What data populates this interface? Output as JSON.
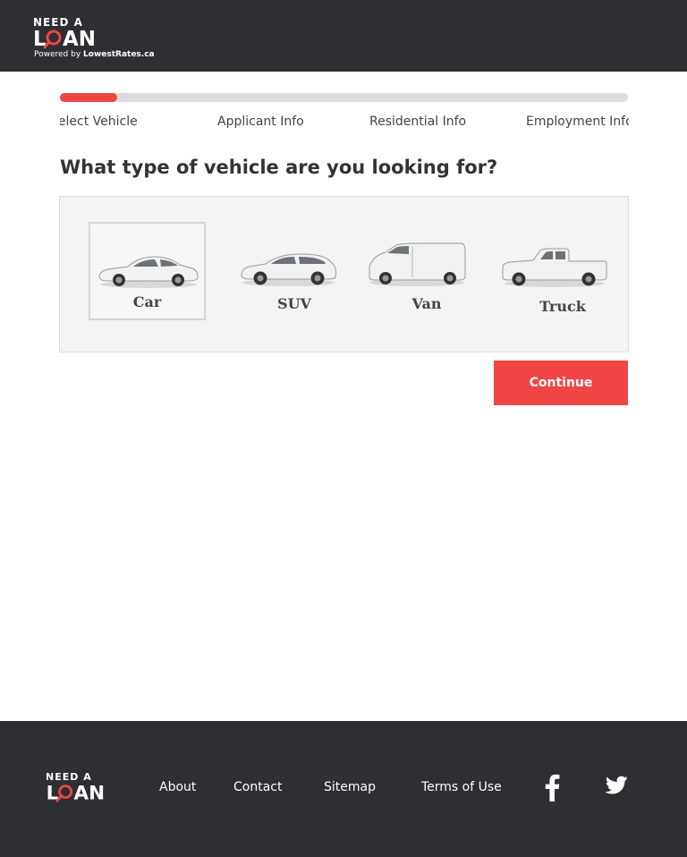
{
  "header": {
    "logo_need": "NEED A",
    "logo_loan": "LOAN",
    "powered_prefix": "Powered by ",
    "powered_brand": "LowestRates.ca"
  },
  "progress": {
    "fraction": 0.1,
    "steps": [
      "Select Vehicle",
      "Applicant Info",
      "Residential Info",
      "Employment Info"
    ]
  },
  "question": "What type of vehicle are you looking for?",
  "vehicles": [
    {
      "label": "Car",
      "icon": "car-icon",
      "selected": true
    },
    {
      "label": "SUV",
      "icon": "suv-icon",
      "selected": false
    },
    {
      "label": "Van",
      "icon": "van-icon",
      "selected": false
    },
    {
      "label": "Truck",
      "icon": "truck-icon",
      "selected": false
    }
  ],
  "continue_label": "Continue",
  "footer": {
    "logo_need": "NEED A",
    "logo_loan": "LOAN",
    "links": [
      "About",
      "Contact",
      "Sitemap",
      "Terms of Use"
    ],
    "social": [
      "facebook-icon",
      "twitter-icon"
    ]
  },
  "colors": {
    "accent": "#f04545",
    "dark": "#2d2f33",
    "panel": "#f4f4f4",
    "track": "#dcdcdc"
  }
}
